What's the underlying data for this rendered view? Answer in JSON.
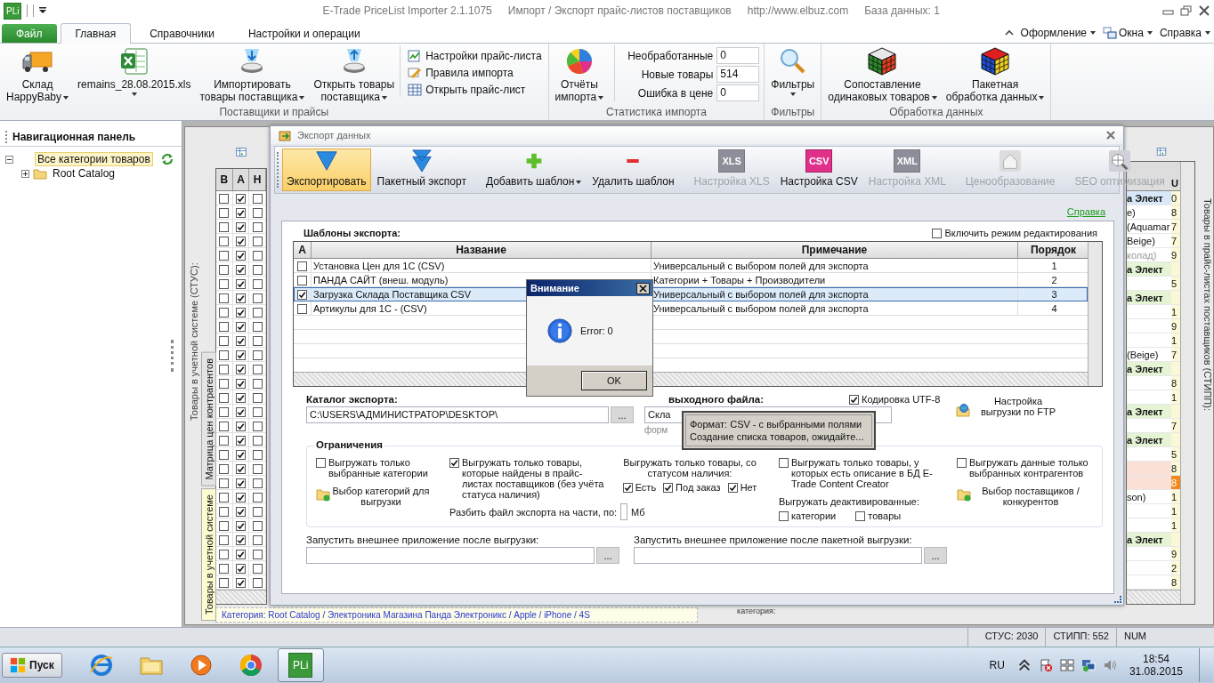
{
  "titlebar": {
    "app_badge": "PLi",
    "title": "E-Trade PriceList Importer 2.1.1075",
    "subtitle": "Импорт / Экспорт прайс-листов поставщиков",
    "url": "http://www.elbuz.com",
    "database": "База данных: 1"
  },
  "ribbon_tabs": [
    {
      "label": "Файл",
      "kind": "file",
      "selected": false
    },
    {
      "label": "Главная",
      "kind": "tab",
      "selected": true
    },
    {
      "label": "Справочники",
      "kind": "tab",
      "selected": false
    },
    {
      "label": "Настройки и операции",
      "kind": "tab",
      "selected": false
    }
  ],
  "ribbon_menus": [
    "Оформление",
    "Окна",
    "Справка"
  ],
  "ribbon_groups": [
    {
      "label": "Поставщики и прайсы",
      "items": [
        {
          "kind": "large",
          "lines": [
            "Склад",
            "HappyBaby"
          ],
          "dropdown": true
        },
        {
          "kind": "large",
          "lines": [
            "remains_28.08.2015.xls"
          ],
          "dropdown": true
        },
        {
          "kind": "large",
          "lines": [
            "Импортировать",
            "товары поставщика"
          ],
          "dropdown": true
        },
        {
          "kind": "large",
          "lines": [
            "Открыть товары",
            "поставщика"
          ],
          "dropdown": true
        },
        {
          "kind": "small-stack",
          "entries": [
            "Настройки прайс-листа",
            "Правила импорта",
            "Открыть прайс-лист"
          ]
        }
      ]
    },
    {
      "label": "Статистика импорта",
      "items": [
        {
          "kind": "large",
          "lines": [
            "Отчёты",
            "импорта"
          ],
          "dropdown": true
        },
        {
          "kind": "stats",
          "rows": [
            {
              "label": "Необработанные",
              "value": "0"
            },
            {
              "label": "Новые товары",
              "value": "514"
            },
            {
              "label": "Ошибка в цене",
              "value": "0"
            }
          ]
        }
      ]
    },
    {
      "label": "Фильтры",
      "items": [
        {
          "kind": "large",
          "lines": [
            "Фильтры"
          ],
          "dropdown": true
        }
      ]
    },
    {
      "label": "Обработка данных",
      "items": [
        {
          "kind": "large",
          "lines": [
            "Сопоставление",
            "одинаковых товаров"
          ],
          "dropdown": true
        },
        {
          "kind": "large",
          "lines": [
            "Пакетная",
            "обработка данных"
          ],
          "dropdown": true
        }
      ]
    }
  ],
  "nav": {
    "title": "Навигационная панель",
    "tree": [
      {
        "label": "Все категории товаров",
        "selected": true,
        "expanded": true,
        "children": [
          {
            "label": "Root Catalog",
            "selected": false,
            "expanded": false
          }
        ]
      }
    ]
  },
  "background": {
    "left_caption": "Товары в учетной системе (СТУС):",
    "side_tabs": [
      {
        "label": "Матрица цен контрагентов",
        "selected": false
      },
      {
        "label": "Товары в учетной системе",
        "selected": true
      }
    ],
    "right_caption": "Товары в прайс-листах поставщиков (СТИПП):",
    "breadcrumb": "Категория: Root Catalog / Электроника Магазина Панда Электроникс / Apple / iPhone / 4S",
    "under_label": "категория:",
    "left_grid": {
      "columns": [
        "В",
        "А",
        "Н"
      ],
      "rows": [
        {
          "cells": [
            false,
            true,
            false
          ]
        },
        {
          "cells": [
            false,
            true,
            false
          ]
        },
        {
          "cells": [
            false,
            true,
            false
          ]
        },
        {
          "cells": [
            false,
            true,
            false
          ]
        },
        {
          "cells": [
            false,
            true,
            false
          ]
        },
        {
          "cells": [
            false,
            true,
            false
          ]
        },
        {
          "cells": [
            false,
            true,
            false
          ]
        },
        {
          "cells": [
            false,
            true,
            false
          ]
        },
        {
          "cells": [
            false,
            true,
            false
          ]
        },
        {
          "cells": [
            false,
            true,
            false
          ]
        },
        {
          "cells": [
            false,
            true,
            false
          ]
        },
        {
          "cells": [
            false,
            true,
            false
          ]
        },
        {
          "cells": [
            false,
            true,
            false
          ]
        },
        {
          "cells": [
            false,
            true,
            false
          ]
        },
        {
          "cells": [
            false,
            true,
            false
          ]
        },
        {
          "cells": [
            false,
            true,
            false
          ]
        },
        {
          "cells": [
            false,
            true,
            false
          ]
        },
        {
          "cells": [
            false,
            true,
            false
          ]
        },
        {
          "cells": [
            false,
            true,
            false
          ]
        },
        {
          "cells": [
            false,
            true,
            false
          ]
        },
        {
          "cells": [
            false,
            true,
            false
          ]
        },
        {
          "cells": [
            false,
            true,
            false
          ]
        },
        {
          "cells": [
            false,
            true,
            false
          ]
        },
        {
          "cells": [
            false,
            true,
            false
          ]
        },
        {
          "cells": [
            false,
            true,
            false
          ]
        },
        {
          "cells": [
            false,
            true,
            false
          ]
        },
        {
          "cells": [
            false,
            true,
            false
          ]
        },
        {
          "cells": [
            false,
            true,
            false
          ]
        }
      ]
    },
    "right_grid": {
      "value_header": "U",
      "rows": [
        {
          "kind": "group",
          "text": "а Элект",
          "value": "0",
          "selected": true
        },
        {
          "kind": "item",
          "text": "e)",
          "value": "8",
          "selected": false
        },
        {
          "kind": "item",
          "text": "(Aquamar",
          "value": "7",
          "selected": false
        },
        {
          "kind": "item",
          "text": "Beige)",
          "value": "7",
          "selected": false
        },
        {
          "kind": "inactive",
          "text": "колад)",
          "value": "9",
          "selected": false
        },
        {
          "kind": "group",
          "text": "а Элект",
          "value": "",
          "selected": false
        },
        {
          "kind": "item",
          "text": "",
          "value": "5",
          "selected": false
        },
        {
          "kind": "group",
          "text": "а Элект",
          "value": "",
          "selected": false
        },
        {
          "kind": "item",
          "text": "",
          "value": "1",
          "selected": false
        },
        {
          "kind": "item",
          "text": "",
          "value": "9",
          "selected": false
        },
        {
          "kind": "item",
          "text": "",
          "value": "1",
          "selected": false
        },
        {
          "kind": "item",
          "text": "(Beige)",
          "value": "7",
          "selected": false
        },
        {
          "kind": "group",
          "text": "а Элект",
          "value": "",
          "selected": false
        },
        {
          "kind": "item",
          "text": "",
          "value": "8",
          "selected": false
        },
        {
          "kind": "item",
          "text": "",
          "value": "1",
          "selected": false
        },
        {
          "kind": "group",
          "text": "а Элект",
          "value": "",
          "selected": false
        },
        {
          "kind": "item",
          "text": "",
          "value": "7",
          "selected": false
        },
        {
          "kind": "group",
          "text": "а Элект",
          "value": "",
          "selected": false
        },
        {
          "kind": "item",
          "text": "",
          "value": "5",
          "selected": false
        },
        {
          "kind": "alert",
          "text": "",
          "value": "8",
          "selected": false,
          "flagged": false
        },
        {
          "kind": "alert",
          "text": "",
          "value": "8",
          "selected": false,
          "flagged": true
        },
        {
          "kind": "item",
          "text": "son)",
          "value": "1",
          "selected": false
        },
        {
          "kind": "item",
          "text": "",
          "value": "1",
          "selected": false
        },
        {
          "kind": "item",
          "text": "",
          "value": "1",
          "selected": false
        },
        {
          "kind": "group",
          "text": "а Элект",
          "value": "",
          "selected": false
        },
        {
          "kind": "item",
          "text": "",
          "value": "9",
          "selected": false
        },
        {
          "kind": "item",
          "text": "",
          "value": "2",
          "selected": false
        },
        {
          "kind": "item",
          "text": "",
          "value": "8",
          "selected": false
        }
      ]
    }
  },
  "dialog": {
    "title": "Экспорт данных",
    "toolbar": [
      {
        "buttons": [
          {
            "label": "Экспортировать",
            "selected": true,
            "disabled": false
          },
          {
            "label": "Пакетный экспорт",
            "selected": false,
            "disabled": false
          }
        ]
      },
      {
        "buttons": [
          {
            "label": "Добавить шаблон",
            "selected": false,
            "disabled": false,
            "dropdown": true
          },
          {
            "label": "Удалить шаблон",
            "selected": false,
            "disabled": false
          }
        ]
      },
      {
        "buttons": [
          {
            "label": "Настройка XLS",
            "badge": "XLS",
            "selected": false,
            "disabled": true
          },
          {
            "label": "Настройка CSV",
            "badge": "CSV",
            "selected": false,
            "disabled": false
          },
          {
            "label": "Настройка XML",
            "badge": "XML",
            "selected": false,
            "disabled": true
          }
        ]
      },
      {
        "buttons": [
          {
            "label": "Ценообразование",
            "selected": false,
            "disabled": true
          }
        ]
      },
      {
        "buttons": [
          {
            "label": "SEO оптимизация",
            "selected": false,
            "disabled": true
          }
        ]
      }
    ],
    "help_link": "Справка",
    "templates": {
      "title": "Шаблоны экспорта:",
      "edit_mode": {
        "label": "Включить режим редактирования",
        "checked": false
      },
      "columns": [
        "А",
        "Название",
        "Примечание",
        "Порядок"
      ],
      "rows": [
        {
          "checked": false,
          "selected": false,
          "name": "Установка Цен для 1С (CSV)",
          "note": "Универсальный с выбором полей для экспорта",
          "order": "1"
        },
        {
          "checked": false,
          "selected": false,
          "name": "ПАНДА САЙТ (внеш. модуль)",
          "note": "Категории + Товары + Производители",
          "order": "2"
        },
        {
          "checked": true,
          "selected": true,
          "name": "Загрузка Склада Поставщика CSV",
          "note": "Универсальный с выбором полей для экспорта",
          "order": "3"
        },
        {
          "checked": false,
          "selected": false,
          "name": "Артикулы для 1С - (CSV)",
          "note": "Универсальный с выбором полей для экспорта",
          "order": "4"
        }
      ]
    },
    "catalog": {
      "label": "Каталог экспорта:",
      "value": "C:\\USERS\\АДМИНИСТРАТОР\\DESKTOP\\",
      "browse": "..."
    },
    "output": {
      "label": "выходного файла:",
      "value": "Скла",
      "hint": "форм",
      "utf8": {
        "label": "Кодировка UTF-8",
        "checked": true
      },
      "ftp": "Настройка выгрузки по FTP"
    },
    "limits": {
      "title": "Ограничения",
      "selected_categories": {
        "label": "Выгружать только выбранные категории",
        "checked": false
      },
      "categories_button": "Выбор категорий для выгрузки",
      "found_only": {
        "label": "Выгружать только товары, которые найдены в прайс-листах поставщиков (без учёта статуса наличия)",
        "checked": true
      },
      "split_label": "Разбить файл экспорта на части, по:",
      "split_unit": "Мб",
      "status_label": "Выгружать только товары, со статусом наличия:",
      "statuses": [
        {
          "label": "Есть",
          "checked": true
        },
        {
          "label": "Под заказ",
          "checked": true
        },
        {
          "label": "Нет",
          "checked": true
        }
      ],
      "with_description": {
        "label": "Выгружать только товары, у которых есть описание в БД E-Trade Content Creator",
        "checked": false
      },
      "deactivated_label": "Выгружать деактивированные:",
      "deactivated": [
        {
          "label": "категории",
          "checked": false
        },
        {
          "label": "товары",
          "checked": false
        }
      ],
      "selected_contractors": {
        "label": "Выгружать данные только выбранных контрагентов",
        "checked": false
      },
      "suppliers_button": "Выбор поставщиков / конкурентов"
    },
    "after_export": {
      "label": "Запустить внешнее приложение после выгрузки:",
      "browse": "..."
    },
    "after_batch": {
      "label": "Запустить внешнее приложение после пакетной выгрузки:",
      "browse": "..."
    },
    "tooltip": [
      "Формат: CSV - с выбранными полями",
      "Создание списка товаров, ожидайте..."
    ]
  },
  "alert": {
    "title": "Внимание",
    "message": "Error: 0",
    "button": "OK"
  },
  "status_bar": [
    "СТУС: 2030",
    "СТИПП: 552",
    "NUM"
  ],
  "taskbar": {
    "start": "Пуск",
    "apps": [
      {
        "selected": false
      },
      {
        "selected": false
      },
      {
        "selected": false
      },
      {
        "selected": false
      },
      {
        "selected": true,
        "label": "PLi"
      }
    ],
    "language": "RU",
    "time": "18:54",
    "date": "31.08.2015"
  }
}
